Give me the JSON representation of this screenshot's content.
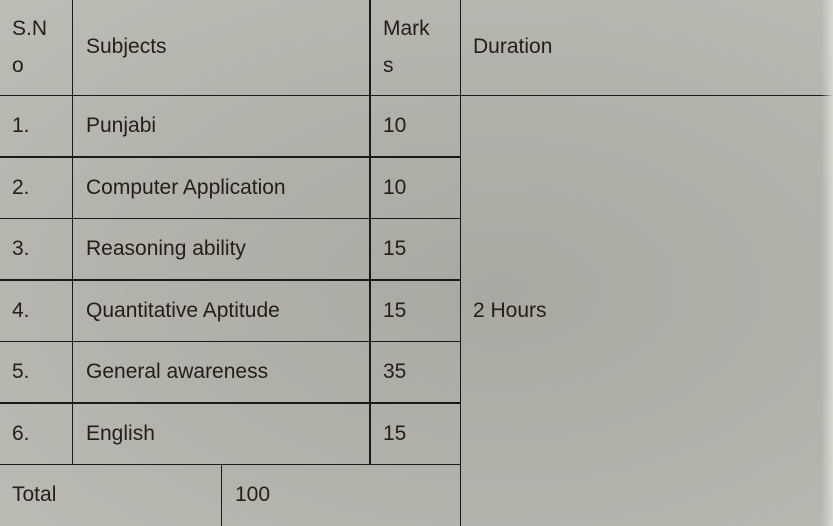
{
  "table": {
    "headers": {
      "sno_line1": "S.N",
      "sno_line2": "o",
      "subjects": "Subjects",
      "marks_line1": "Mark",
      "marks_line2": "s",
      "duration": "Duration"
    },
    "rows": [
      {
        "sno": "1.",
        "subject": "Punjabi",
        "marks": "10"
      },
      {
        "sno": "2.",
        "subject": "Computer Application",
        "marks": "10"
      },
      {
        "sno": "3.",
        "subject": "Reasoning ability",
        "marks": "15"
      },
      {
        "sno": "4.",
        "subject": "Quantitative Aptitude",
        "marks": "15"
      },
      {
        "sno": "5.",
        "subject": "General awareness",
        "marks": "35"
      },
      {
        "sno": "6.",
        "subject": "English",
        "marks": "15"
      }
    ],
    "duration_value": "2 Hours",
    "total_label": "Total",
    "total_value": "100"
  }
}
